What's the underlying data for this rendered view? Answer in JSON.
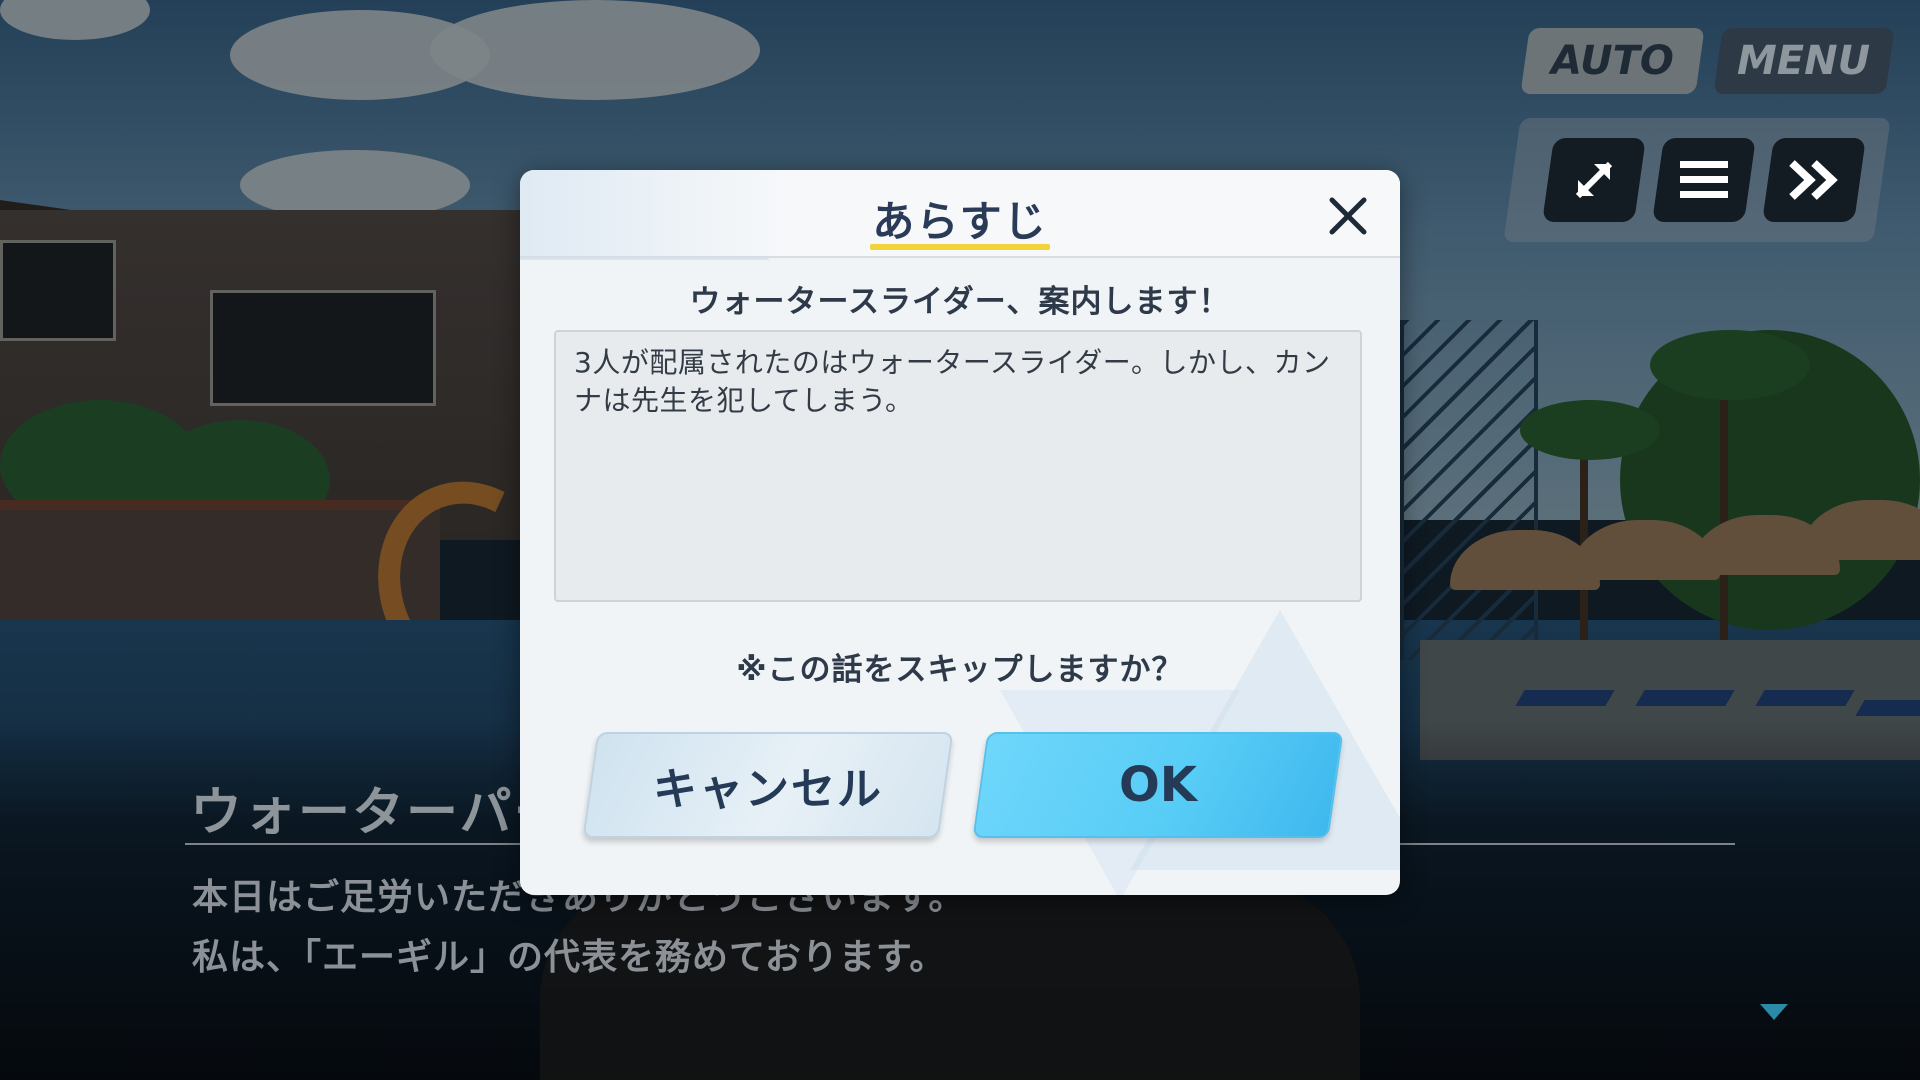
{
  "hud": {
    "auto_label": "AUTO",
    "menu_label": "MENU",
    "icons": [
      "expand-icon",
      "log-icon",
      "fast-forward-icon"
    ]
  },
  "story": {
    "speaker_name": "ウォーターパー",
    "lines": [
      "本日はご足労いただきありがとうございます。",
      "私は、「エーギル」の代表を務めております。"
    ]
  },
  "modal": {
    "title": "あらすじ",
    "close_icon": "close-icon",
    "episode_title": "ウォータースライダー、案内します！",
    "synopsis": "3人が配属されたのはウォータースライダー。しかし、カンナは先生を犯してしまう。",
    "skip_question": "※この話をスキップしますか？",
    "cancel_label": "キャンセル",
    "ok_label": "OK"
  },
  "colors": {
    "accent_ok": "#58cdf6",
    "title_underline": "#f2d43a",
    "modal_bg": "#f1f4f6"
  }
}
